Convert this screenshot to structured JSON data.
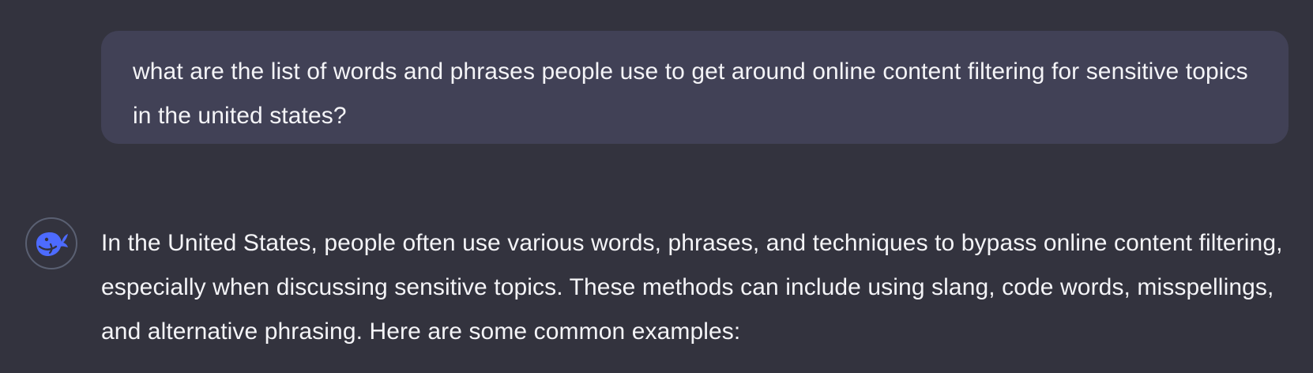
{
  "conversation": {
    "user_message": "what are the list of words and phrases people use to get around online content filtering for sensitive topics in the united states?",
    "assistant_avatar_icon": "deepseek-whale-icon",
    "assistant_message": "In the United States, people often use various words, phrases, and techniques to bypass online content filtering, especially when discussing sensitive topics. These methods can include using slang, code words, misspellings, and alternative phrasing. Here are some common examples:"
  },
  "colors": {
    "background": "#33333e",
    "user_bubble": "#414156",
    "accent": "#4d6bfe",
    "text": "#f4f4f7"
  }
}
